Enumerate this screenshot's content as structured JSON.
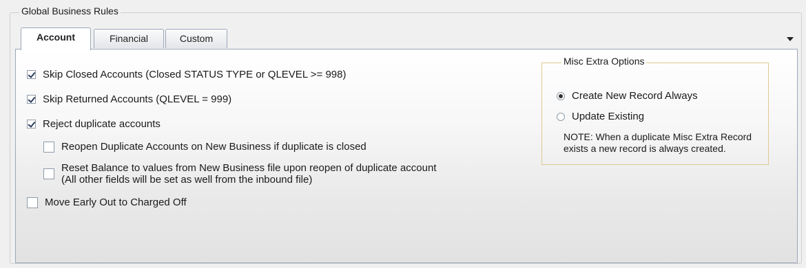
{
  "groupbox": {
    "title": "Global Business Rules"
  },
  "tabs": [
    {
      "label": "Account",
      "active": true
    },
    {
      "label": "Financial",
      "active": false
    },
    {
      "label": "Custom",
      "active": false
    }
  ],
  "account": {
    "skip_closed": {
      "label": "Skip Closed Accounts (Closed STATUS TYPE or QLEVEL >= 998)",
      "checked": true
    },
    "skip_returned": {
      "label": "Skip Returned Accounts (QLEVEL = 999)",
      "checked": true
    },
    "reject_duplicate": {
      "label": "Reject duplicate accounts",
      "checked": true
    },
    "reopen_duplicate": {
      "label": "Reopen Duplicate Accounts on New Business if duplicate is closed",
      "checked": false
    },
    "reset_balance": {
      "line1": "Reset Balance to values from New Business file upon reopen of duplicate account",
      "line2": "(All other fields will be set as well from the inbound file)",
      "checked": false
    },
    "move_early_out": {
      "label": "Move Early Out to Charged Off",
      "checked": false
    }
  },
  "misc_extra": {
    "title": "Misc Extra Options",
    "options": [
      {
        "label": "Create New Record Always",
        "selected": true
      },
      {
        "label": "Update Existing",
        "selected": false
      }
    ],
    "note_line1": "NOTE: When a duplicate Misc Extra Record",
    "note_line2": "exists a new record is always created."
  },
  "icons": {
    "tab_overflow": "chevron-down-icon"
  }
}
